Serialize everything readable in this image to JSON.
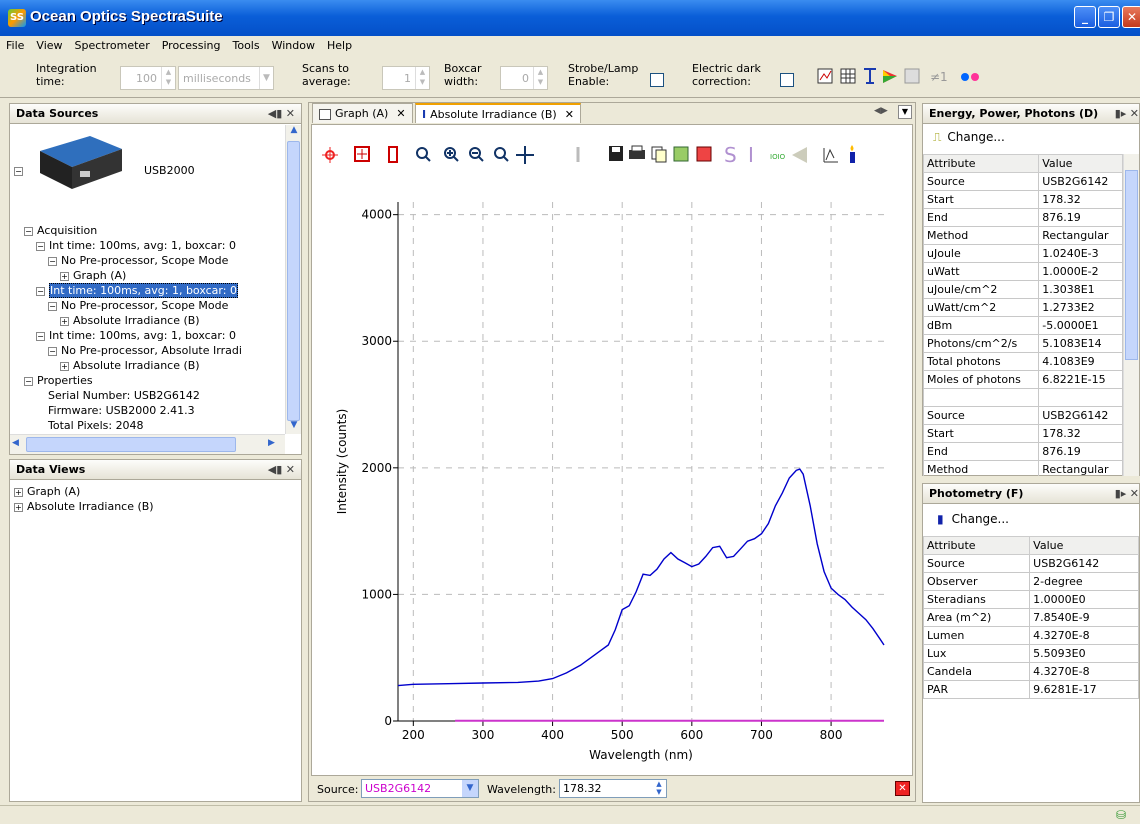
{
  "window": {
    "title": "Ocean Optics SpectraSuite",
    "logo": "SS"
  },
  "menu": [
    "File",
    "View",
    "Spectrometer",
    "Processing",
    "Tools",
    "Window",
    "Help"
  ],
  "toolbar": {
    "integration_label": "Integration\ntime:",
    "integration_value": "100",
    "integration_unit": "milliseconds",
    "scans_label": "Scans to\naverage:",
    "scans_value": "1",
    "boxcar_label": "Boxcar\nwidth:",
    "boxcar_value": "0",
    "strobe_label": "Strobe/Lamp\nEnable:",
    "dark_label": "Electric dark\ncorrection:",
    "ne1": "≠1"
  },
  "data_sources": {
    "title": "Data Sources",
    "device": "USB2000",
    "tree": [
      {
        "text": "Acquisition",
        "indent": 0,
        "sign": "−"
      },
      {
        "text": "Int time: 100ms, avg: 1, boxcar: 0",
        "indent": 1,
        "sign": "−"
      },
      {
        "text": "No Pre-processor, Scope Mode",
        "indent": 2,
        "sign": "−"
      },
      {
        "text": "Graph (A)",
        "indent": 3,
        "sign": "+"
      },
      {
        "text": "Int time: 100ms, avg: 1, boxcar: 0",
        "indent": 1,
        "sign": "−",
        "selected": true
      },
      {
        "text": "No Pre-processor, Scope Mode",
        "indent": 2,
        "sign": "−"
      },
      {
        "text": "Absolute Irradiance (B)",
        "indent": 3,
        "sign": "+"
      },
      {
        "text": "Int time: 100ms, avg: 1, boxcar: 0",
        "indent": 1,
        "sign": "−"
      },
      {
        "text": "No Pre-processor, Absolute Irradi",
        "indent": 2,
        "sign": "−"
      },
      {
        "text": "Absolute Irradiance (B)",
        "indent": 3,
        "sign": "+"
      },
      {
        "text": "Properties",
        "indent": 0,
        "sign": "−"
      },
      {
        "text": "Serial Number: USB2G6142",
        "indent": 2,
        "sign": ""
      },
      {
        "text": "Firmware: USB2000 2.41.3",
        "indent": 2,
        "sign": ""
      },
      {
        "text": "Total Pixels: 2048",
        "indent": 2,
        "sign": ""
      }
    ]
  },
  "data_views": {
    "title": "Data Views",
    "items": [
      "Graph (A)",
      "Absolute Irradiance (B)"
    ]
  },
  "tabs": {
    "graph": "Graph (A)",
    "irr": "Absolute Irradiance (B)"
  },
  "chart_data": {
    "type": "line",
    "xlabel": "Wavelength (nm)",
    "ylabel": "Intensity (counts)",
    "xlim": [
      178,
      876
    ],
    "ylim": [
      0,
      4100
    ],
    "xticks": [
      200,
      300,
      400,
      500,
      600,
      700,
      800
    ],
    "yticks": [
      0,
      1000,
      2000,
      3000,
      4000
    ],
    "grid": true,
    "series": [
      {
        "color": "#0000cc",
        "x": [
          178,
          200,
          250,
          300,
          350,
          380,
          400,
          420,
          440,
          460,
          470,
          480,
          490,
          500,
          510,
          520,
          530,
          540,
          550,
          560,
          570,
          580,
          590,
          600,
          610,
          620,
          630,
          640,
          650,
          660,
          670,
          680,
          690,
          700,
          710,
          720,
          730,
          740,
          750,
          755,
          760,
          770,
          780,
          790,
          800,
          810,
          820,
          830,
          840,
          850,
          860,
          870,
          876
        ],
        "y": [
          280,
          290,
          295,
          300,
          305,
          315,
          335,
          380,
          440,
          520,
          560,
          600,
          720,
          880,
          910,
          1020,
          1160,
          1150,
          1200,
          1280,
          1330,
          1280,
          1250,
          1220,
          1240,
          1300,
          1370,
          1380,
          1290,
          1300,
          1360,
          1420,
          1440,
          1480,
          1560,
          1700,
          1800,
          1920,
          1980,
          1990,
          1950,
          1700,
          1400,
          1180,
          1050,
          1000,
          960,
          900,
          850,
          800,
          730,
          650,
          600
        ]
      },
      {
        "color": "#cc33cc",
        "x": [
          260,
          876
        ],
        "y": [
          2,
          2
        ]
      }
    ]
  },
  "source_bar": {
    "source_label": "Source:",
    "source_value": "USB2G6142",
    "wl_label": "Wavelength:",
    "wl_value": "178.32"
  },
  "energy": {
    "title": "Energy, Power, Photons (D)",
    "change": "Change...",
    "header": [
      "Attribute",
      "Value"
    ],
    "rows": [
      [
        "Source",
        "USB2G6142"
      ],
      [
        "Start",
        "178.32"
      ],
      [
        "End",
        "876.19"
      ],
      [
        "Method",
        "Rectangular"
      ],
      [
        "uJoule",
        "1.0240E-3"
      ],
      [
        "uWatt",
        "1.0000E-2"
      ],
      [
        "uJoule/cm^2",
        "1.3038E1"
      ],
      [
        "uWatt/cm^2",
        "1.2733E2"
      ],
      [
        "dBm",
        "-5.0000E1"
      ],
      [
        "Photons/cm^2/s",
        "5.1083E14"
      ],
      [
        "Total photons",
        "4.1083E9"
      ],
      [
        "Moles of photons",
        "6.8221E-15"
      ],
      [
        "",
        ""
      ],
      [
        "Source",
        "USB2G6142"
      ],
      [
        "Start",
        "178.32"
      ],
      [
        "End",
        "876.19"
      ],
      [
        "Method",
        "Rectangular"
      ]
    ]
  },
  "photometry": {
    "title": "Photometry (F)",
    "change": "Change...",
    "header": [
      "Attribute",
      "Value"
    ],
    "rows": [
      [
        "Source",
        "USB2G6142"
      ],
      [
        "Observer",
        "2-degree"
      ],
      [
        "Steradians",
        "1.0000E0"
      ],
      [
        "Area (m^2)",
        "7.8540E-9"
      ],
      [
        "Lumen",
        "4.3270E-8"
      ],
      [
        "Lux",
        "5.5093E0"
      ],
      [
        "Candela",
        "4.3270E-8"
      ],
      [
        " PAR",
        "9.6281E-17"
      ]
    ]
  }
}
